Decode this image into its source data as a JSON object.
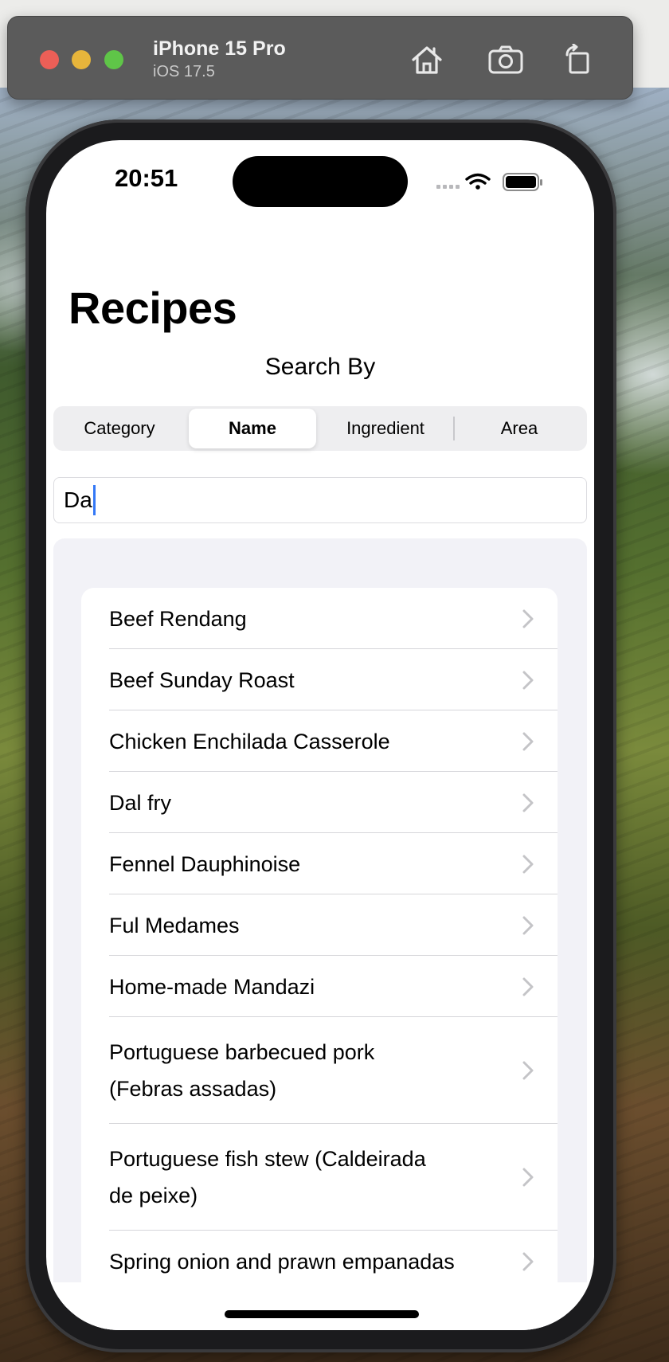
{
  "simulator": {
    "device_name": "iPhone 15 Pro",
    "os_version": "iOS 17.5",
    "buttons": [
      "home-icon",
      "screenshot-icon",
      "rotate-icon"
    ]
  },
  "status_bar": {
    "time": "20:51"
  },
  "screen": {
    "title": "Recipes",
    "search_by_label": "Search By",
    "segments": [
      {
        "label": "Category",
        "selected": false
      },
      {
        "label": "Name",
        "selected": true
      },
      {
        "label": "Ingredient",
        "selected": false
      },
      {
        "label": "Area",
        "selected": false
      }
    ],
    "search_value": "Da",
    "results": [
      {
        "line1": "Beef Rendang",
        "line2": ""
      },
      {
        "line1": "Beef Sunday Roast",
        "line2": ""
      },
      {
        "line1": "Chicken Enchilada Casserole",
        "line2": ""
      },
      {
        "line1": "Dal fry",
        "line2": ""
      },
      {
        "line1": "Fennel Dauphinoise",
        "line2": ""
      },
      {
        "line1": "Ful Medames",
        "line2": ""
      },
      {
        "line1": "Home-made Mandazi",
        "line2": ""
      },
      {
        "line1": "Portuguese barbecued pork",
        "line2": "(Febras assadas)"
      },
      {
        "line1": "Portuguese fish stew (Caldeirada",
        "line2": "de peixe)"
      },
      {
        "line1": "Spring onion and prawn empanadas",
        "line2": ""
      }
    ]
  },
  "colors": {
    "accent": "#3478f6",
    "chevron": "#c4c4c7"
  }
}
